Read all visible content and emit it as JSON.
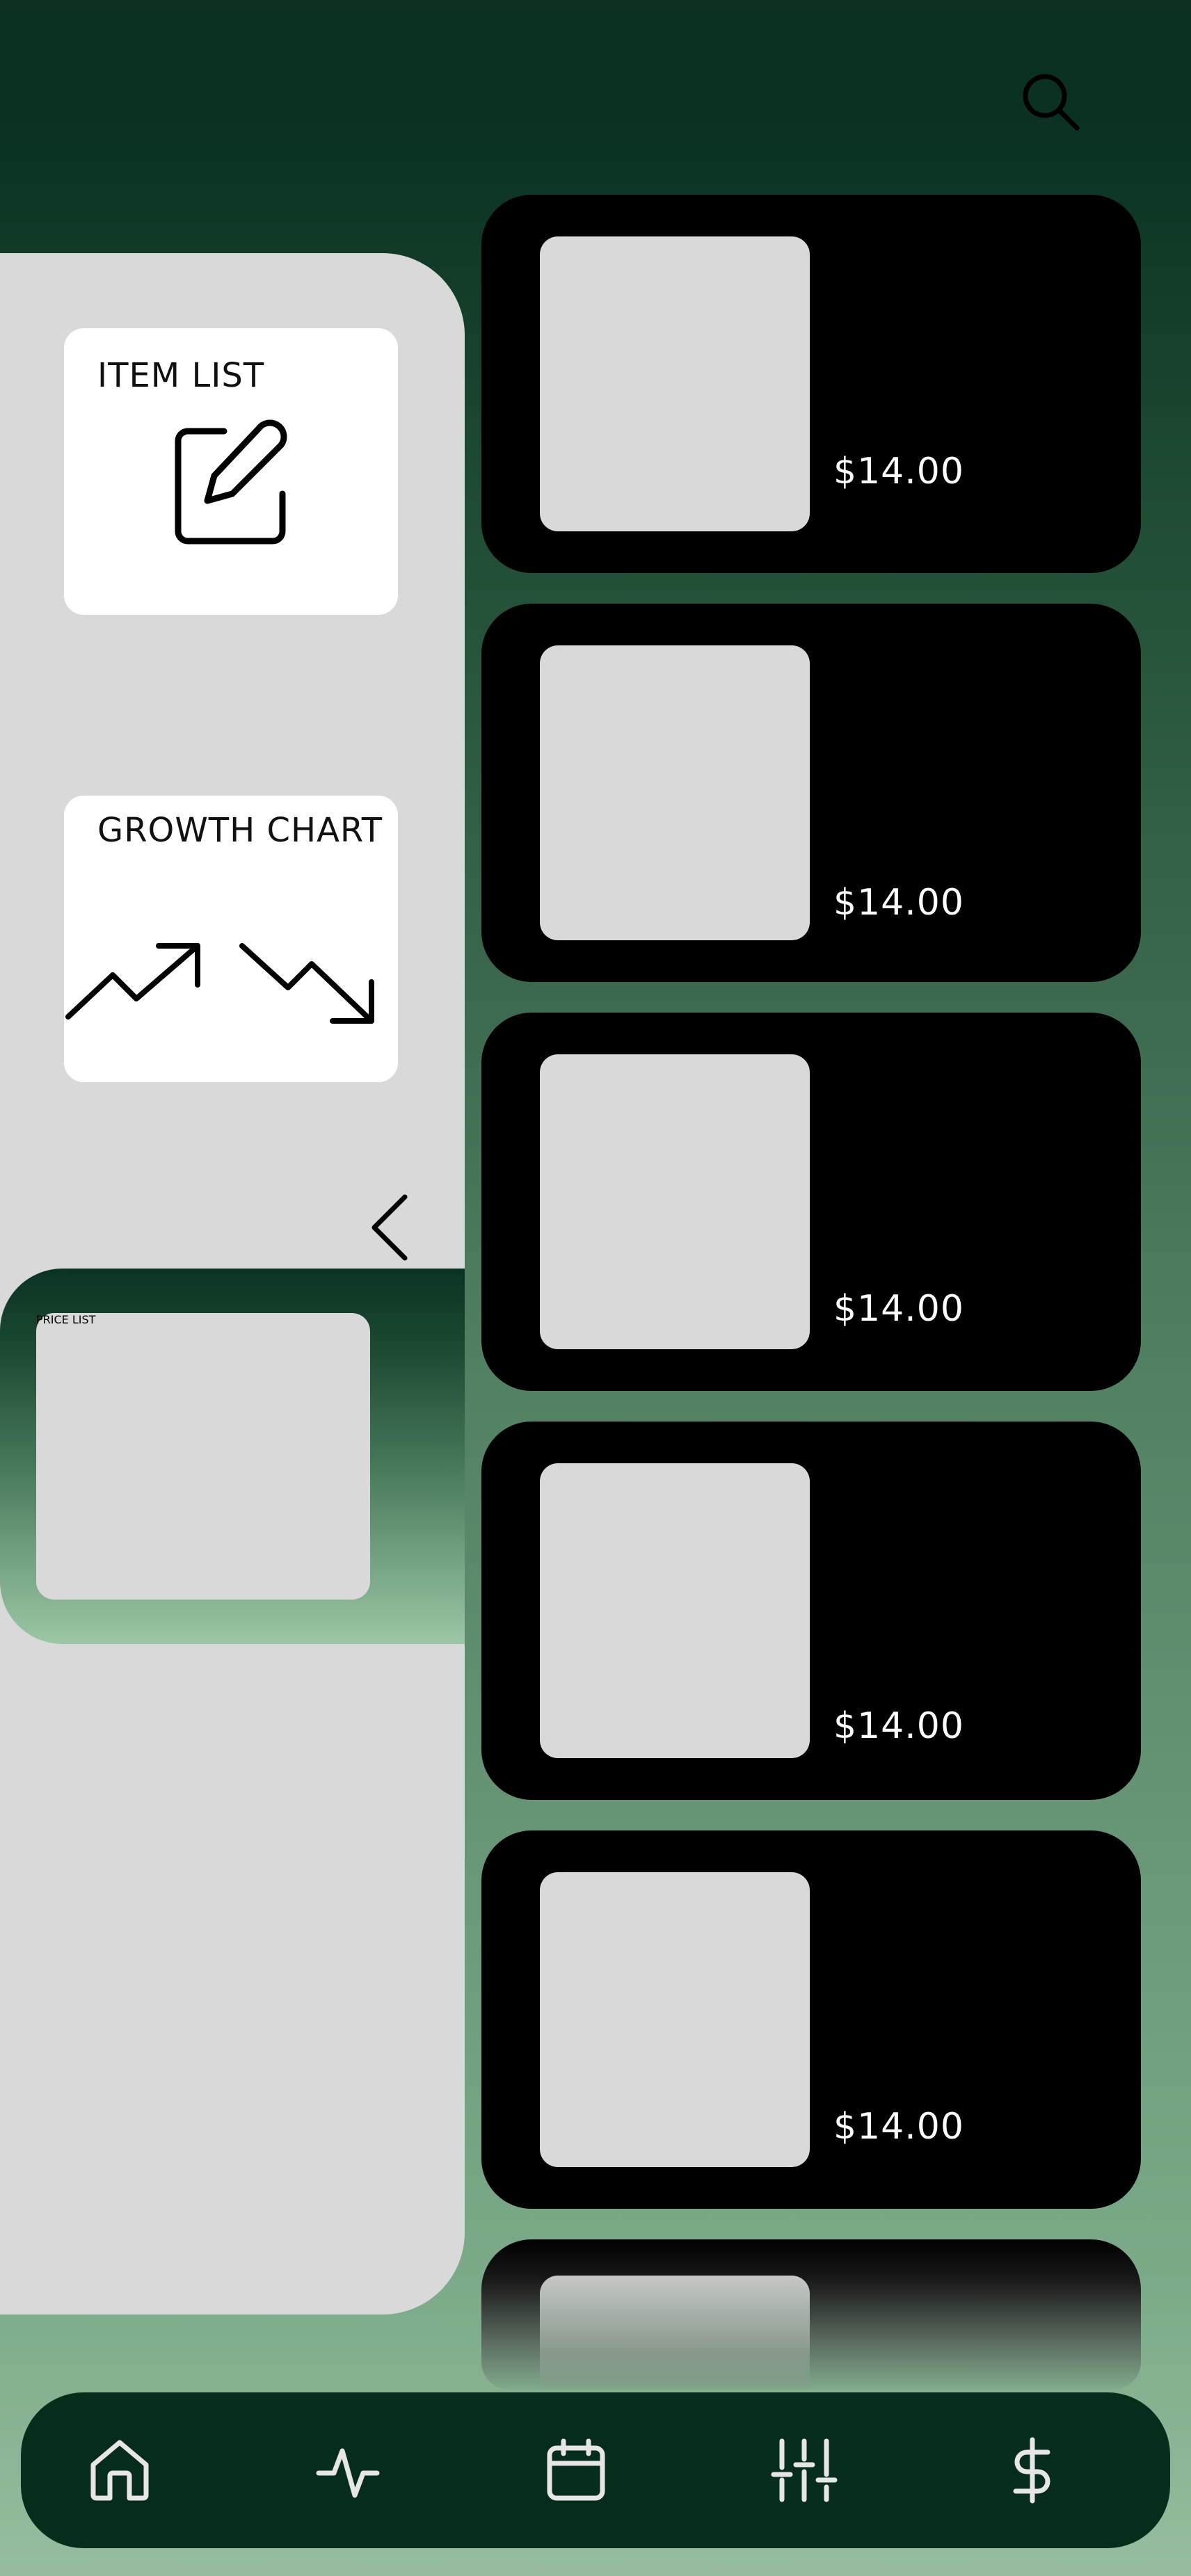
{
  "header": {
    "search_icon": "search-icon"
  },
  "side_panel": {
    "cards": [
      {
        "label": "ITEM LIST",
        "icon": "edit-icon"
      },
      {
        "label": "GROWTH CHART",
        "icon": "trending-icons"
      },
      {
        "label": "PRICE LIST"
      }
    ],
    "back_icon": "chevron-left-icon"
  },
  "items": [
    {
      "price": "$14.00"
    },
    {
      "price": "$14.00"
    },
    {
      "price": "$14.00"
    },
    {
      "price": "$14.00"
    },
    {
      "price": "$14.00"
    }
  ],
  "bottom_nav": [
    {
      "icon": "home-icon"
    },
    {
      "icon": "activity-icon"
    },
    {
      "icon": "calendar-icon"
    },
    {
      "icon": "sliders-icon"
    },
    {
      "icon": "dollar-icon"
    }
  ],
  "colors": {
    "dark_green": "#0a2f1f",
    "nav_green": "#062d1c",
    "light_green": "#96bd9f",
    "panel_gray": "#d9d9d9",
    "card_black": "#000000"
  }
}
